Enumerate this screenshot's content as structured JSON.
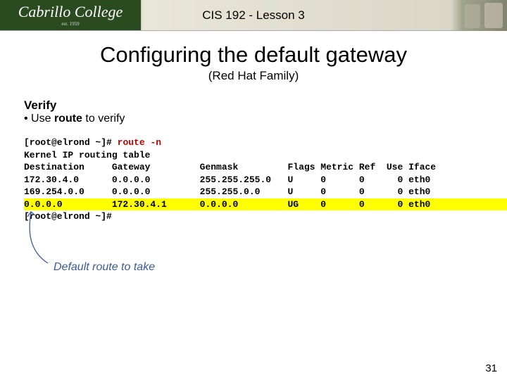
{
  "banner": {
    "logo_text": "Cabrillo College",
    "logo_sub": "est. 1959",
    "title": "CIS 192 - Lesson 3"
  },
  "slide": {
    "title": "Configuring the default gateway",
    "subtitle": "(Red Hat Family)"
  },
  "verify": {
    "heading": "Verify",
    "bullet_prefix": "• Use ",
    "bullet_cmd": "route",
    "bullet_suffix": " to verify"
  },
  "terminal": {
    "prompt": "[root@elrond ~]#",
    "command": "route -n",
    "line2": "Kernel IP routing table",
    "header": {
      "dest": "Destination",
      "gw": "Gateway",
      "mask": "Genmask",
      "flags": "Flags",
      "metric": "Metric",
      "ref": "Ref",
      "use": "Use",
      "iface": "Iface"
    },
    "rows": [
      {
        "dest": "172.30.4.0",
        "gw": "0.0.0.0",
        "mask": "255.255.255.0",
        "flags": "U",
        "metric": "0",
        "ref": "0",
        "use": "0",
        "iface": "eth0"
      },
      {
        "dest": "169.254.0.0",
        "gw": "0.0.0.0",
        "mask": "255.255.0.0",
        "flags": "U",
        "metric": "0",
        "ref": "0",
        "use": "0",
        "iface": "eth0"
      },
      {
        "dest": "0.0.0.0",
        "gw": "172.30.4.1",
        "mask": "0.0.0.0",
        "flags": "UG",
        "metric": "0",
        "ref": "0",
        "use": "0",
        "iface": "eth0"
      }
    ],
    "prompt2": "[root@elrond ~]#"
  },
  "annotation": "Default route to take",
  "page_number": "31",
  "chart_data": {
    "type": "table",
    "title": "Kernel IP routing table",
    "columns": [
      "Destination",
      "Gateway",
      "Genmask",
      "Flags",
      "Metric",
      "Ref",
      "Use",
      "Iface"
    ],
    "rows": [
      [
        "172.30.4.0",
        "0.0.0.0",
        "255.255.255.0",
        "U",
        0,
        0,
        0,
        "eth0"
      ],
      [
        "169.254.0.0",
        "0.0.0.0",
        "255.255.0.0",
        "U",
        0,
        0,
        0,
        "eth0"
      ],
      [
        "0.0.0.0",
        "172.30.4.1",
        "0.0.0.0",
        "UG",
        0,
        0,
        0,
        "eth0"
      ]
    ],
    "highlight_row_index": 2,
    "annotations": [
      "Default route to take"
    ]
  }
}
